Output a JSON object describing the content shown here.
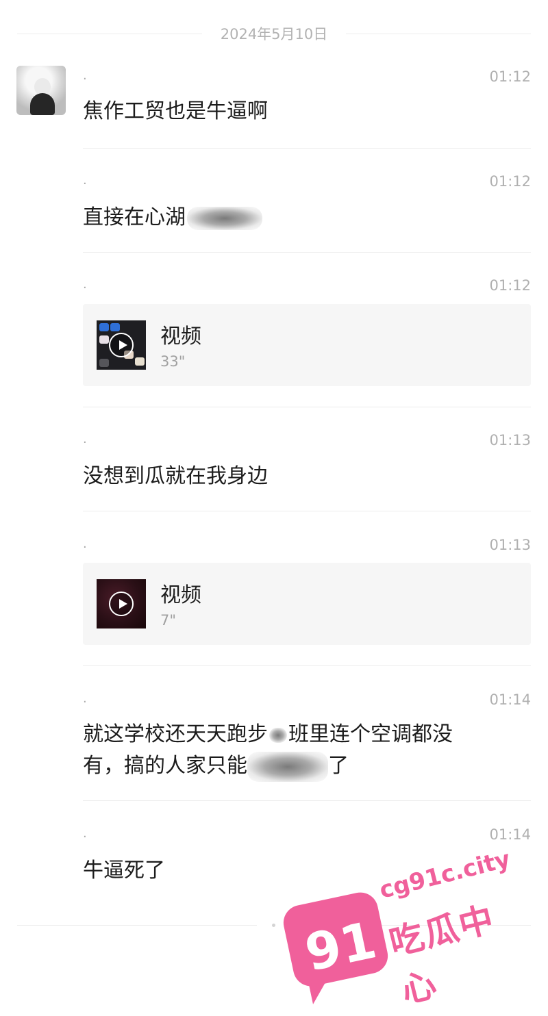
{
  "date_separator": "2024年5月10日",
  "messages": [
    {
      "sender": ".",
      "time": "01:12",
      "text": "焦作工贸也是牛逼啊"
    },
    {
      "sender": ".",
      "time": "01:12",
      "text": "直接在心湖"
    },
    {
      "sender": ".",
      "time": "01:12",
      "video": {
        "title": "视频",
        "duration": "33\""
      }
    },
    {
      "sender": ".",
      "time": "01:13",
      "text": "没想到瓜就在我身边"
    },
    {
      "sender": ".",
      "time": "01:13",
      "video": {
        "title": "视频",
        "duration": "7\""
      }
    },
    {
      "sender": ".",
      "time": "01:14",
      "text_line1": "就这学校还天天跑步",
      "text_line1b": "班里连个空调都没",
      "text_line2": "有，搞的人家只能",
      "text_line2b": "了"
    },
    {
      "sender": ".",
      "time": "01:14",
      "text": "牛逼死了"
    }
  ],
  "watermark": {
    "number": "91",
    "url": "cg91c.city",
    "name": "吃瓜中心",
    "color": "#f0609b"
  },
  "icons": [
    "avatar-image",
    "play-icon"
  ]
}
